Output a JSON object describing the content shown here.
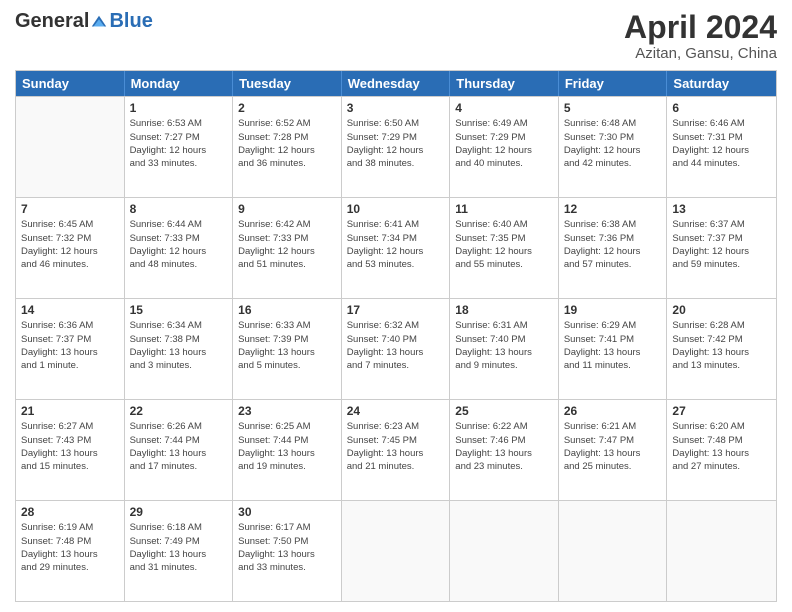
{
  "header": {
    "logo_general": "General",
    "logo_blue": "Blue",
    "title": "April 2024",
    "location": "Azitan, Gansu, China"
  },
  "calendar": {
    "weekdays": [
      "Sunday",
      "Monday",
      "Tuesday",
      "Wednesday",
      "Thursday",
      "Friday",
      "Saturday"
    ],
    "rows": [
      [
        {
          "day": "",
          "empty": true,
          "info": ""
        },
        {
          "day": "1",
          "empty": false,
          "info": "Sunrise: 6:53 AM\nSunset: 7:27 PM\nDaylight: 12 hours\nand 33 minutes."
        },
        {
          "day": "2",
          "empty": false,
          "info": "Sunrise: 6:52 AM\nSunset: 7:28 PM\nDaylight: 12 hours\nand 36 minutes."
        },
        {
          "day": "3",
          "empty": false,
          "info": "Sunrise: 6:50 AM\nSunset: 7:29 PM\nDaylight: 12 hours\nand 38 minutes."
        },
        {
          "day": "4",
          "empty": false,
          "info": "Sunrise: 6:49 AM\nSunset: 7:29 PM\nDaylight: 12 hours\nand 40 minutes."
        },
        {
          "day": "5",
          "empty": false,
          "info": "Sunrise: 6:48 AM\nSunset: 7:30 PM\nDaylight: 12 hours\nand 42 minutes."
        },
        {
          "day": "6",
          "empty": false,
          "info": "Sunrise: 6:46 AM\nSunset: 7:31 PM\nDaylight: 12 hours\nand 44 minutes."
        }
      ],
      [
        {
          "day": "7",
          "empty": false,
          "info": "Sunrise: 6:45 AM\nSunset: 7:32 PM\nDaylight: 12 hours\nand 46 minutes."
        },
        {
          "day": "8",
          "empty": false,
          "info": "Sunrise: 6:44 AM\nSunset: 7:33 PM\nDaylight: 12 hours\nand 48 minutes."
        },
        {
          "day": "9",
          "empty": false,
          "info": "Sunrise: 6:42 AM\nSunset: 7:33 PM\nDaylight: 12 hours\nand 51 minutes."
        },
        {
          "day": "10",
          "empty": false,
          "info": "Sunrise: 6:41 AM\nSunset: 7:34 PM\nDaylight: 12 hours\nand 53 minutes."
        },
        {
          "day": "11",
          "empty": false,
          "info": "Sunrise: 6:40 AM\nSunset: 7:35 PM\nDaylight: 12 hours\nand 55 minutes."
        },
        {
          "day": "12",
          "empty": false,
          "info": "Sunrise: 6:38 AM\nSunset: 7:36 PM\nDaylight: 12 hours\nand 57 minutes."
        },
        {
          "day": "13",
          "empty": false,
          "info": "Sunrise: 6:37 AM\nSunset: 7:37 PM\nDaylight: 12 hours\nand 59 minutes."
        }
      ],
      [
        {
          "day": "14",
          "empty": false,
          "info": "Sunrise: 6:36 AM\nSunset: 7:37 PM\nDaylight: 13 hours\nand 1 minute."
        },
        {
          "day": "15",
          "empty": false,
          "info": "Sunrise: 6:34 AM\nSunset: 7:38 PM\nDaylight: 13 hours\nand 3 minutes."
        },
        {
          "day": "16",
          "empty": false,
          "info": "Sunrise: 6:33 AM\nSunset: 7:39 PM\nDaylight: 13 hours\nand 5 minutes."
        },
        {
          "day": "17",
          "empty": false,
          "info": "Sunrise: 6:32 AM\nSunset: 7:40 PM\nDaylight: 13 hours\nand 7 minutes."
        },
        {
          "day": "18",
          "empty": false,
          "info": "Sunrise: 6:31 AM\nSunset: 7:40 PM\nDaylight: 13 hours\nand 9 minutes."
        },
        {
          "day": "19",
          "empty": false,
          "info": "Sunrise: 6:29 AM\nSunset: 7:41 PM\nDaylight: 13 hours\nand 11 minutes."
        },
        {
          "day": "20",
          "empty": false,
          "info": "Sunrise: 6:28 AM\nSunset: 7:42 PM\nDaylight: 13 hours\nand 13 minutes."
        }
      ],
      [
        {
          "day": "21",
          "empty": false,
          "info": "Sunrise: 6:27 AM\nSunset: 7:43 PM\nDaylight: 13 hours\nand 15 minutes."
        },
        {
          "day": "22",
          "empty": false,
          "info": "Sunrise: 6:26 AM\nSunset: 7:44 PM\nDaylight: 13 hours\nand 17 minutes."
        },
        {
          "day": "23",
          "empty": false,
          "info": "Sunrise: 6:25 AM\nSunset: 7:44 PM\nDaylight: 13 hours\nand 19 minutes."
        },
        {
          "day": "24",
          "empty": false,
          "info": "Sunrise: 6:23 AM\nSunset: 7:45 PM\nDaylight: 13 hours\nand 21 minutes."
        },
        {
          "day": "25",
          "empty": false,
          "info": "Sunrise: 6:22 AM\nSunset: 7:46 PM\nDaylight: 13 hours\nand 23 minutes."
        },
        {
          "day": "26",
          "empty": false,
          "info": "Sunrise: 6:21 AM\nSunset: 7:47 PM\nDaylight: 13 hours\nand 25 minutes."
        },
        {
          "day": "27",
          "empty": false,
          "info": "Sunrise: 6:20 AM\nSunset: 7:48 PM\nDaylight: 13 hours\nand 27 minutes."
        }
      ],
      [
        {
          "day": "28",
          "empty": false,
          "info": "Sunrise: 6:19 AM\nSunset: 7:48 PM\nDaylight: 13 hours\nand 29 minutes."
        },
        {
          "day": "29",
          "empty": false,
          "info": "Sunrise: 6:18 AM\nSunset: 7:49 PM\nDaylight: 13 hours\nand 31 minutes."
        },
        {
          "day": "30",
          "empty": false,
          "info": "Sunrise: 6:17 AM\nSunset: 7:50 PM\nDaylight: 13 hours\nand 33 minutes."
        },
        {
          "day": "",
          "empty": true,
          "info": ""
        },
        {
          "day": "",
          "empty": true,
          "info": ""
        },
        {
          "day": "",
          "empty": true,
          "info": ""
        },
        {
          "day": "",
          "empty": true,
          "info": ""
        }
      ]
    ]
  }
}
